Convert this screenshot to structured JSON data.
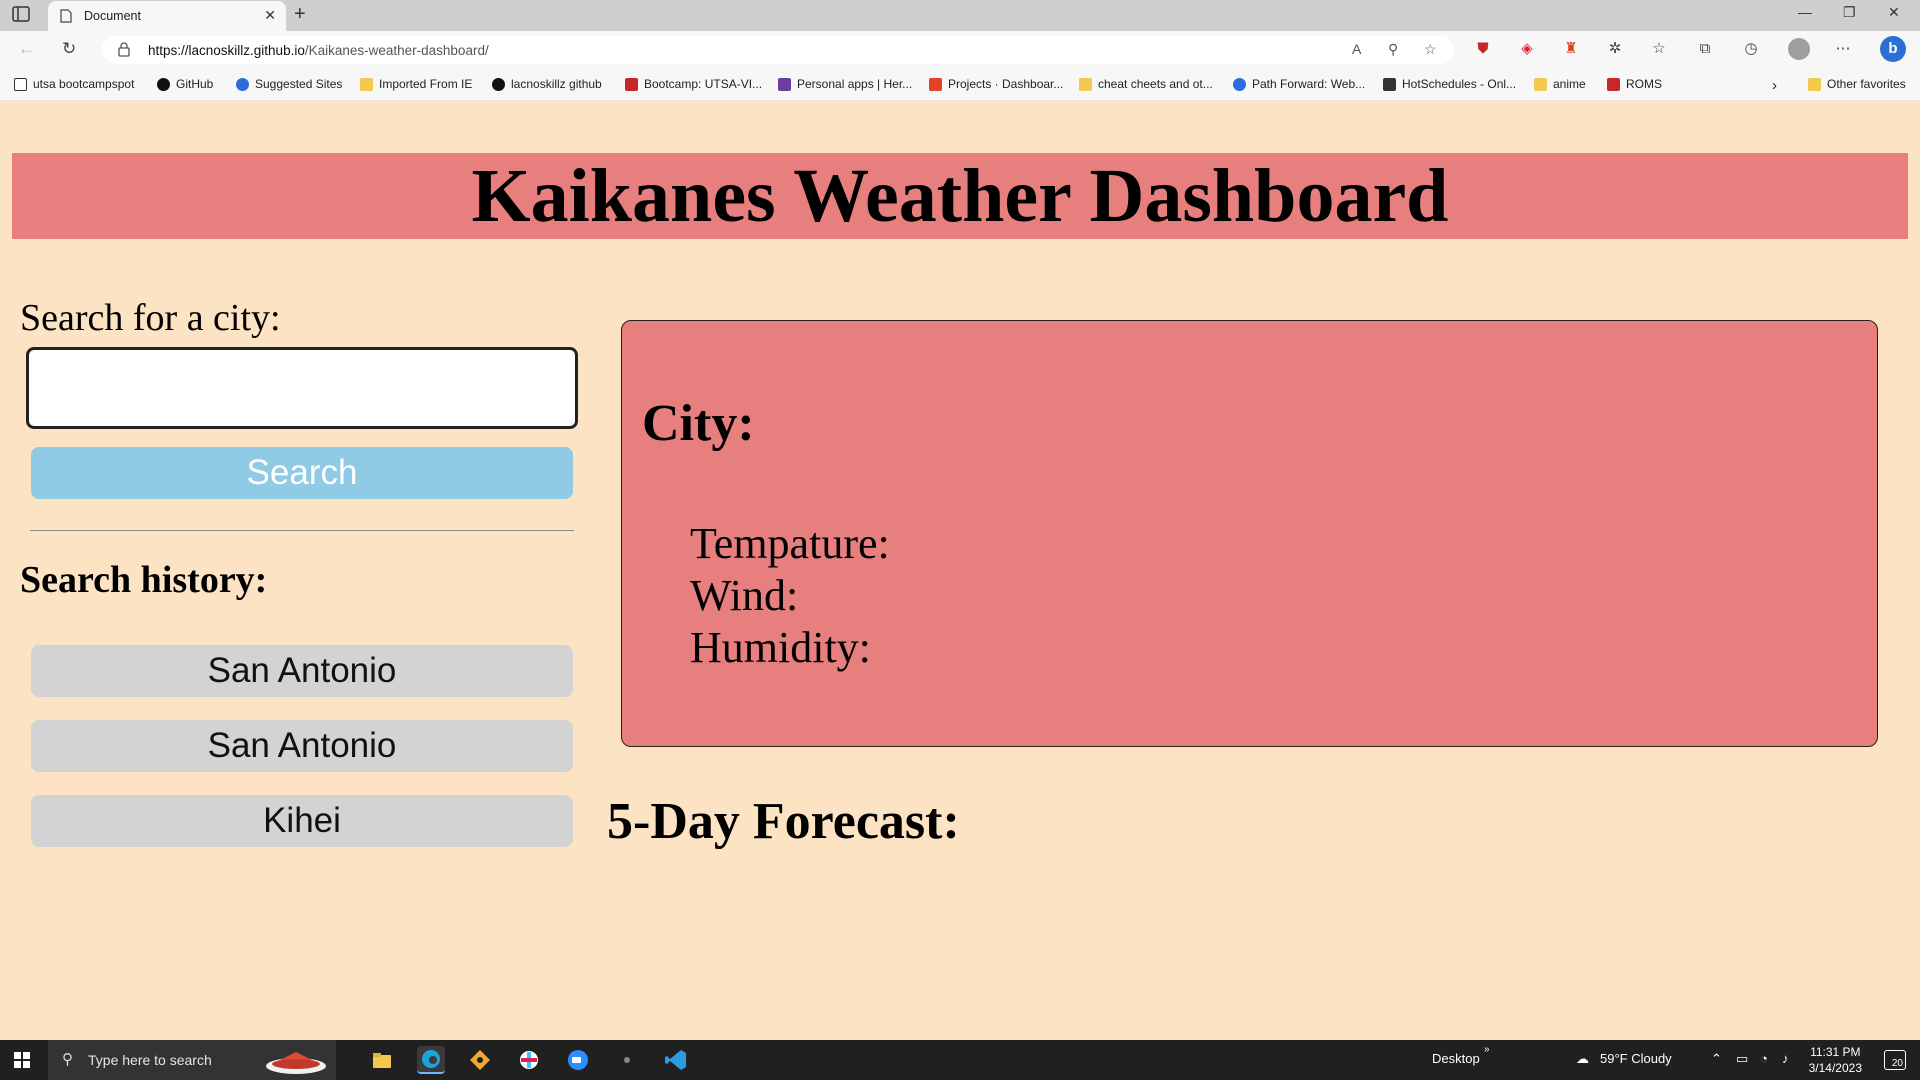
{
  "browser": {
    "tab_title": "Document",
    "url_host": "https://lacnoskillz.github.io",
    "url_path": "/Kaikanes-weather-dashboard/",
    "bookmarks": [
      "utsa bootcampspot",
      "GitHub",
      "Suggested Sites",
      "Imported From IE",
      "lacnoskillz github",
      "Bootcamp: UTSA-VI...",
      "Personal apps | Her...",
      "Projects · Dashboar...",
      "cheat cheets and ot...",
      "Path Forward: Web...",
      "HotSchedules - Onl...",
      "anime",
      "ROMS"
    ],
    "other_favorites": "Other favorites"
  },
  "page": {
    "title": "Kaikanes Weather Dashboard",
    "search_label": "Search for a city:",
    "search_value": "",
    "search_button": "Search",
    "history_title": "Search history:",
    "history": [
      "San Antonio",
      "San Antonio",
      "Kihei"
    ],
    "city_heading": "City:",
    "temp_label": "Tempature:",
    "wind_label": "Wind:",
    "humidity_label": "Humidity:",
    "forecast_title": "5-Day Forecast:"
  },
  "taskbar": {
    "search_placeholder": "Type here to search",
    "desktop_label": "Desktop",
    "weather": "59°F  Cloudy",
    "time": "11:31 PM",
    "date": "3/14/2023",
    "notifications": "20"
  },
  "colors": {
    "page_bg": "#fce3c3",
    "header_bg": "#e77f7f",
    "search_button_bg": "#8fcbe5",
    "history_button_bg": "#d3d3d3"
  }
}
